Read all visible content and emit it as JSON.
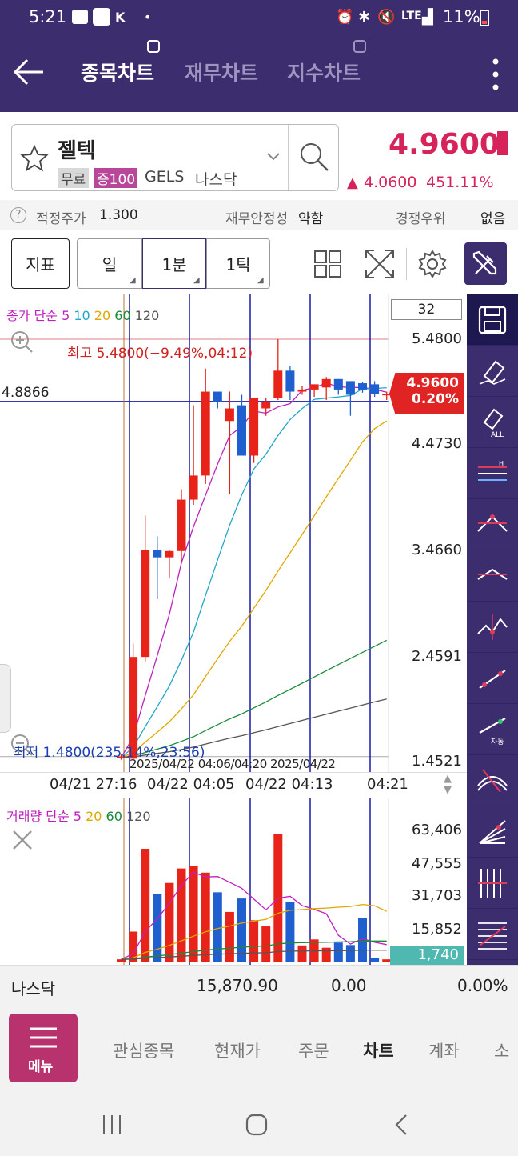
{
  "status_bar": {
    "time": "5:21",
    "battery": "11%",
    "network": "LTE"
  },
  "header": {
    "tabs": [
      "종목차트",
      "재무차트",
      "지수차트"
    ],
    "active_tab": 0
  },
  "stock": {
    "name": "젤텍",
    "tags": [
      "무료",
      "증100"
    ],
    "ticker": "GELS",
    "market": "나스닥",
    "price": "4.9600",
    "change": "4.0600",
    "change_pct": "451.11%"
  },
  "info_row": {
    "fair_price_label": "적정주가",
    "fair_price": "1.300",
    "stability_label": "재무안정성",
    "stability": "약함",
    "competition_label": "경쟁우위",
    "competition": "없음"
  },
  "toolbar": {
    "indicator": "지표",
    "day": "일",
    "minute": "1분",
    "tick": "1틱"
  },
  "chart": {
    "count_box": "32",
    "ma_label_prefix": "종가 단순",
    "ma_periods": [
      "5",
      "10",
      "20",
      "60",
      "120"
    ],
    "high_label": "최고 5.4800(−9.49%,04:12)",
    "low_label": "최저 1.4800(235.14%,23:56)",
    "crosshair_value": "4.8866",
    "current_price": "4.9600",
    "current_pct": "0.20%",
    "y_ticks": [
      "5.4800",
      "4.4730",
      "3.4660",
      "2.4591",
      "1.4521"
    ],
    "overlap_label": "2025/04/22 04:06/04:20 2025/04/22",
    "x_ticks": [
      "04/21 27:16",
      "04/22 04:05",
      "04/22 04:13",
      "04:21"
    ],
    "volume_label_prefix": "거래량 단순",
    "volume_periods": [
      "5",
      "20",
      "60",
      "120"
    ],
    "volume_ticks": [
      "63,406",
      "47,555",
      "31,703",
      "15,852"
    ],
    "volume_current": "1,740",
    "colors": {
      "up": "#e8241a",
      "down": "#1f5fcf",
      "ma5": "#c020c0",
      "ma10": "#20a8c8",
      "ma20": "#e0a800",
      "ma60": "#1a8a3a",
      "ma120": "#555555",
      "vline": "#1a1aa8"
    }
  },
  "chart_data": {
    "type": "candlestick",
    "candles": [
      {
        "o": 1.49,
        "h": 1.52,
        "l": 1.47,
        "c": 1.5
      },
      {
        "o": 1.48,
        "h": 2.58,
        "l": 1.46,
        "c": 2.45
      },
      {
        "o": 2.45,
        "h": 3.8,
        "l": 2.4,
        "c": 3.47
      },
      {
        "o": 3.47,
        "h": 3.6,
        "l": 3.0,
        "c": 3.4
      },
      {
        "o": 3.4,
        "h": 3.47,
        "l": 3.2,
        "c": 3.46
      },
      {
        "o": 3.46,
        "h": 4.05,
        "l": 3.35,
        "c": 3.95
      },
      {
        "o": 3.95,
        "h": 4.85,
        "l": 3.9,
        "c": 4.18
      },
      {
        "o": 4.18,
        "h": 5.2,
        "l": 4.1,
        "c": 4.98
      },
      {
        "o": 4.98,
        "h": 4.93,
        "l": 4.82,
        "c": 4.88
      },
      {
        "o": 4.7,
        "h": 4.98,
        "l": 4.0,
        "c": 4.82
      },
      {
        "o": 4.85,
        "h": 4.95,
        "l": 4.38,
        "c": 4.37
      },
      {
        "o": 4.37,
        "h": 4.9,
        "l": 4.3,
        "c": 4.92
      },
      {
        "o": 4.82,
        "h": 4.92,
        "l": 4.75,
        "c": 4.88
      },
      {
        "o": 4.92,
        "h": 5.48,
        "l": 4.9,
        "c": 5.18
      },
      {
        "o": 5.18,
        "h": 5.22,
        "l": 4.9,
        "c": 4.98
      },
      {
        "o": 4.98,
        "h": 5.03,
        "l": 4.95,
        "c": 5.0
      },
      {
        "o": 5.0,
        "h": 5.0,
        "l": 4.93,
        "c": 5.05
      },
      {
        "o": 5.02,
        "h": 5.12,
        "l": 4.9,
        "c": 5.1
      },
      {
        "o": 5.1,
        "h": 5.1,
        "l": 4.95,
        "c": 5.0
      },
      {
        "o": 5.08,
        "h": 5.08,
        "l": 4.75,
        "c": 4.95
      },
      {
        "o": 5.06,
        "h": 5.07,
        "l": 4.97,
        "c": 5.0
      },
      {
        "o": 5.05,
        "h": 5.08,
        "l": 4.93,
        "c": 4.96
      },
      {
        "o": 4.96,
        "h": 4.98,
        "l": 4.9,
        "c": 4.96
      }
    ],
    "volume": [
      1100,
      14500,
      54500,
      32500,
      38000,
      45000,
      46000,
      43000,
      33500,
      24000,
      30500,
      20000,
      17000,
      61500,
      29000,
      7800,
      10700,
      6700,
      9200,
      8000,
      20900,
      1740,
      1100
    ],
    "y_range": [
      1.4521,
      5.48
    ],
    "volume_range": [
      0,
      63406
    ]
  }
}
